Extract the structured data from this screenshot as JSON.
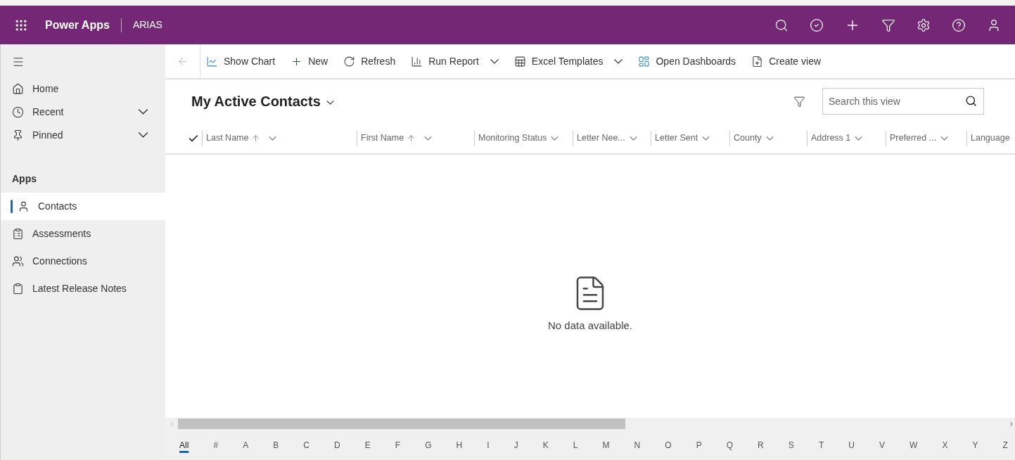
{
  "header": {
    "app_name": "Power Apps",
    "environment": "ARIAS"
  },
  "sidebar": {
    "nav": [
      {
        "label": "Home",
        "kind": "home",
        "expandable": false
      },
      {
        "label": "Recent",
        "kind": "recent",
        "expandable": true
      },
      {
        "label": "Pinned",
        "kind": "pinned",
        "expandable": true
      }
    ],
    "section_title": "Apps",
    "items": [
      {
        "label": "Contacts",
        "kind": "contacts",
        "selected": true
      },
      {
        "label": "Assessments",
        "kind": "assessments",
        "selected": false
      },
      {
        "label": "Connections",
        "kind": "connections",
        "selected": false
      },
      {
        "label": "Latest Release Notes",
        "kind": "notes",
        "selected": false
      }
    ]
  },
  "toolbar": [
    {
      "label": "Show Chart",
      "kind": "chart",
      "dropdown": false
    },
    {
      "label": "New",
      "kind": "new",
      "dropdown": false
    },
    {
      "label": "Refresh",
      "kind": "refresh",
      "dropdown": false
    },
    {
      "label": "Run Report",
      "kind": "report",
      "dropdown": true
    },
    {
      "label": "Excel Templates",
      "kind": "excel",
      "dropdown": true
    },
    {
      "label": "Open Dashboards",
      "kind": "dashboards",
      "dropdown": false
    },
    {
      "label": "Create view",
      "kind": "view",
      "dropdown": false
    }
  ],
  "view": {
    "title": "My Active Contacts",
    "search": {
      "placeholder": "Search this view"
    }
  },
  "table": {
    "columns": [
      {
        "label": "Last Name",
        "sorted": true
      },
      {
        "label": "First Name",
        "sorted": true
      },
      {
        "label": "Monitoring Status",
        "sorted": false
      },
      {
        "label": "Letter Nee...",
        "sorted": false
      },
      {
        "label": "Letter Sent",
        "sorted": false
      },
      {
        "label": "County",
        "sorted": false
      },
      {
        "label": "Address 1",
        "sorted": false
      },
      {
        "label": "Preferred ...",
        "sorted": false
      },
      {
        "label": "Language"
      }
    ],
    "empty_message": "No data available."
  },
  "alphabet": [
    {
      "label": "All",
      "selected": true
    },
    {
      "label": "#",
      "selected": false
    },
    {
      "label": "A",
      "selected": false
    },
    {
      "label": "B",
      "selected": false
    },
    {
      "label": "C",
      "selected": false
    },
    {
      "label": "D",
      "selected": false
    },
    {
      "label": "E",
      "selected": false
    },
    {
      "label": "F",
      "selected": false
    },
    {
      "label": "G",
      "selected": false
    },
    {
      "label": "H",
      "selected": false
    },
    {
      "label": "I",
      "selected": false
    },
    {
      "label": "J",
      "selected": false
    },
    {
      "label": "K",
      "selected": false
    },
    {
      "label": "L",
      "selected": false
    },
    {
      "label": "M",
      "selected": false
    },
    {
      "label": "N",
      "selected": false
    },
    {
      "label": "O",
      "selected": false
    },
    {
      "label": "P",
      "selected": false
    },
    {
      "label": "Q",
      "selected": false
    },
    {
      "label": "R",
      "selected": false
    },
    {
      "label": "S",
      "selected": false
    },
    {
      "label": "T",
      "selected": false
    },
    {
      "label": "U",
      "selected": false
    },
    {
      "label": "V",
      "selected": false
    },
    {
      "label": "W",
      "selected": false
    },
    {
      "label": "X",
      "selected": false
    },
    {
      "label": "Y",
      "selected": false
    },
    {
      "label": "Z",
      "selected": false
    }
  ]
}
